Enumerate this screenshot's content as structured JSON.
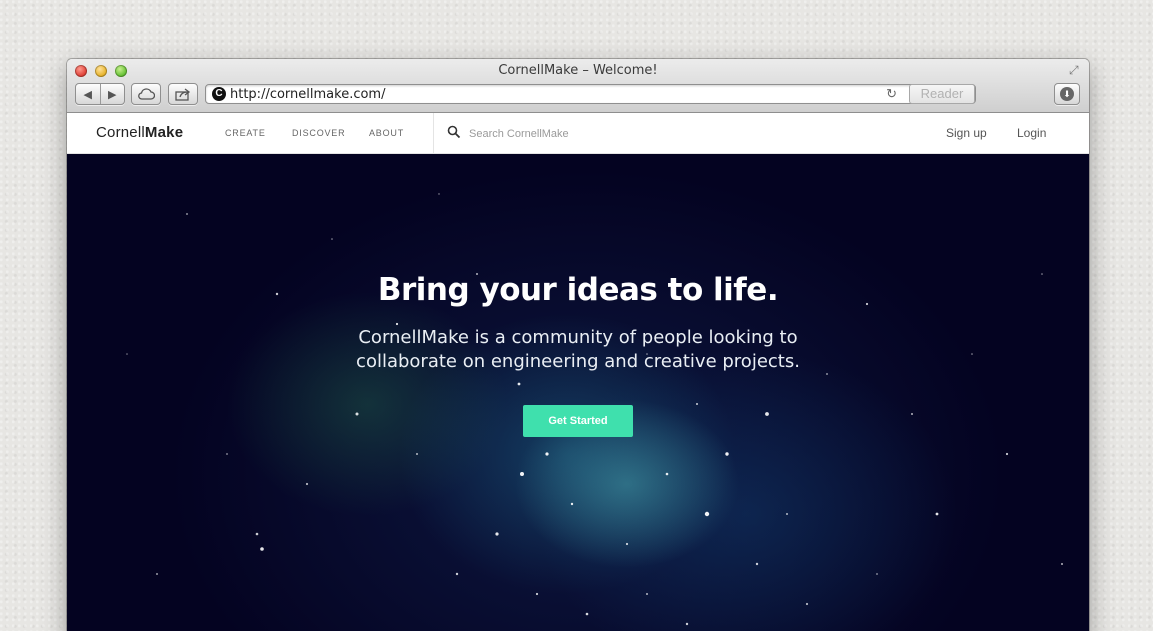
{
  "browser": {
    "window_title": "CornellMake – Welcome!",
    "url": "http://cornellmake.com/",
    "reader_label": "Reader",
    "favicon_letter": "C"
  },
  "site": {
    "logo_light": "Cornell",
    "logo_bold": "Make",
    "nav": {
      "create": "CREATE",
      "discover": "DISCOVER",
      "about": "ABOUT"
    },
    "search_placeholder": "Search CornellMake",
    "signup": "Sign up",
    "login": "Login"
  },
  "hero": {
    "title": "Bring your ideas to life.",
    "subtitle_line1": "CornellMake is a community of people looking to",
    "subtitle_line2": "collaborate on engineering and creative projects.",
    "cta_label": "Get Started"
  },
  "colors": {
    "accent": "#3fe0ad",
    "hero_bg": "#040321"
  }
}
